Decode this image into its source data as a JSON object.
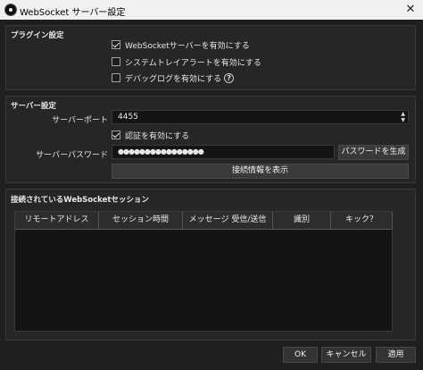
{
  "window": {
    "title": "WebSocket サーバー設定",
    "close_glyph": "✕"
  },
  "plugin_settings": {
    "title": "プラグイン設定",
    "enable_server": {
      "label": "WebSocketサーバーを有効にする",
      "checked": true
    },
    "system_tray_alerts": {
      "label": "システムトレイアラートを有効にする",
      "checked": false
    },
    "debug_log": {
      "label": "デバッグログを有効にする",
      "checked": false,
      "help_glyph": "?"
    }
  },
  "server_settings": {
    "title": "サーバー設定",
    "port_label": "サーバーポート",
    "port_value": "4455",
    "auth": {
      "label": "認証を有効にする",
      "checked": true
    },
    "password_label": "サーバーパスワード",
    "password_value": "●●●●●●●●●●●●●●●●",
    "generate_password_label": "パスワードを生成",
    "show_connect_info_label": "接続情報を表示"
  },
  "sessions": {
    "title": "接続されているWebSocketセッション",
    "columns": [
      "リモートアドレス",
      "セッション時間",
      "メッセージ 受信/送信",
      "識別",
      "キック？"
    ]
  },
  "footer": {
    "ok_label": "OK",
    "cancel_label": "キャンセル",
    "apply_label": "適用"
  }
}
